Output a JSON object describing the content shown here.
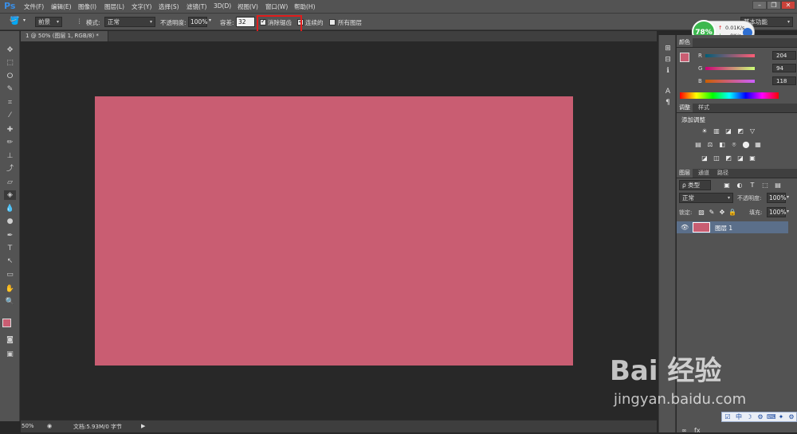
{
  "app": {
    "logo": "Ps"
  },
  "menu": {
    "items": [
      "文件(F)",
      "编辑(E)",
      "图像(I)",
      "图层(L)",
      "文字(Y)",
      "选择(S)",
      "滤镜(T)",
      "3D(D)",
      "视图(V)",
      "窗口(W)",
      "帮助(H)"
    ],
    "highlighted_item": "窗口(W)"
  },
  "window_controls": {
    "minimize": "–",
    "restore": "❐",
    "close": "✕"
  },
  "options": {
    "fill_source": "前景",
    "mode_label": "模式:",
    "mode_value": "正常",
    "opacity_label": "不透明度:",
    "opacity_value": "100%",
    "tolerance_label": "容差:",
    "tolerance_value": "32",
    "antialias_label": "消除锯齿",
    "contiguous_label": "连续的",
    "all_layers_label": "所有图层",
    "workspace": "基本功能"
  },
  "document": {
    "tab_title": "1 @ 50% (图层 1, RGB/8) *",
    "close": "×",
    "fill_color": "#c95d72"
  },
  "status": {
    "zoom": "50%",
    "doc_info": "文档:5.93M/0 字节"
  },
  "color_panel": {
    "tab": "颜色",
    "r_label": "R",
    "r_value": "204",
    "g_label": "G",
    "g_value": "94",
    "b_label": "B",
    "b_value": "118",
    "foreground": "#c95d72",
    "background": "#ffffff"
  },
  "adjust_panel": {
    "tabs": [
      "调整",
      "样式"
    ],
    "title": "添加调整",
    "row1": [
      "☀",
      "▥",
      "◪",
      "◩",
      "▽"
    ],
    "row2": [
      "▤",
      "⚖",
      "◧",
      "⌾",
      "⬤",
      "▦"
    ],
    "row3": [
      "◪",
      "◫",
      "◩",
      "◪",
      "▣"
    ]
  },
  "layers_panel": {
    "tabs": [
      "图层",
      "通道",
      "路径"
    ],
    "filter_label": "ρ 类型",
    "filter_icons": [
      "▣",
      "◐",
      "T",
      "⬚",
      "▤"
    ],
    "blend_mode": "正常",
    "opacity_label": "不透明度:",
    "opacity_value": "100%",
    "lock_label": "锁定:",
    "lock_icons": [
      "▨",
      "✎",
      "✥",
      "🔒"
    ],
    "fill_label": "填充:",
    "fill_value": "100%",
    "layer_name": "图层 1",
    "bottom_icons": [
      "∞",
      "fx"
    ]
  },
  "net_widget": {
    "percent": "78%",
    "up": "0.01K/s",
    "down": "0K/s"
  },
  "watermark": {
    "brand": "Bai 经验",
    "url": "jingyan.baidu.com"
  },
  "tray": {
    "icons": [
      "☑",
      "中",
      "☽",
      "⚙",
      "⌨",
      "✦",
      "⚙"
    ]
  }
}
